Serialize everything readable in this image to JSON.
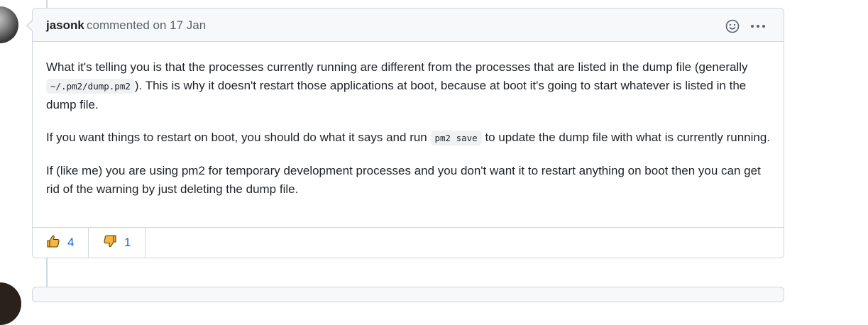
{
  "comment": {
    "author": "jasonk",
    "meta": "commented on 17 Jan",
    "paragraph1": {
      "text_a": "What it's telling you is that the processes currently running are different from the processes that are listed in the dump file (generally ",
      "code": "~/.pm2/dump.pm2",
      "text_b": "). This is why it doesn't restart those applications at boot, because at boot it's going to start whatever is listed in the dump file."
    },
    "paragraph2": {
      "text_a": "If you want things to restart on boot, you should do what it says and run ",
      "code": "pm2 save",
      "text_b": " to update the dump file with what is currently running."
    },
    "paragraph3": "If (like me) you are using pm2 for temporary development processes and you don't want it to restart anything on boot then you can get rid of the warning by just deleting the dump file.",
    "reactions": [
      {
        "icon": "thumbs-up-icon",
        "count": "4"
      },
      {
        "icon": "thumbs-down-icon",
        "count": "1"
      }
    ]
  },
  "icons": {
    "add_reaction": "smiley-icon",
    "more": "kebab-horizontal-icon"
  },
  "colors": {
    "link": "#0969da",
    "border": "#d0d7de",
    "header_bg": "#f6f8fa",
    "emoji_yellow": "#f4b63f"
  }
}
